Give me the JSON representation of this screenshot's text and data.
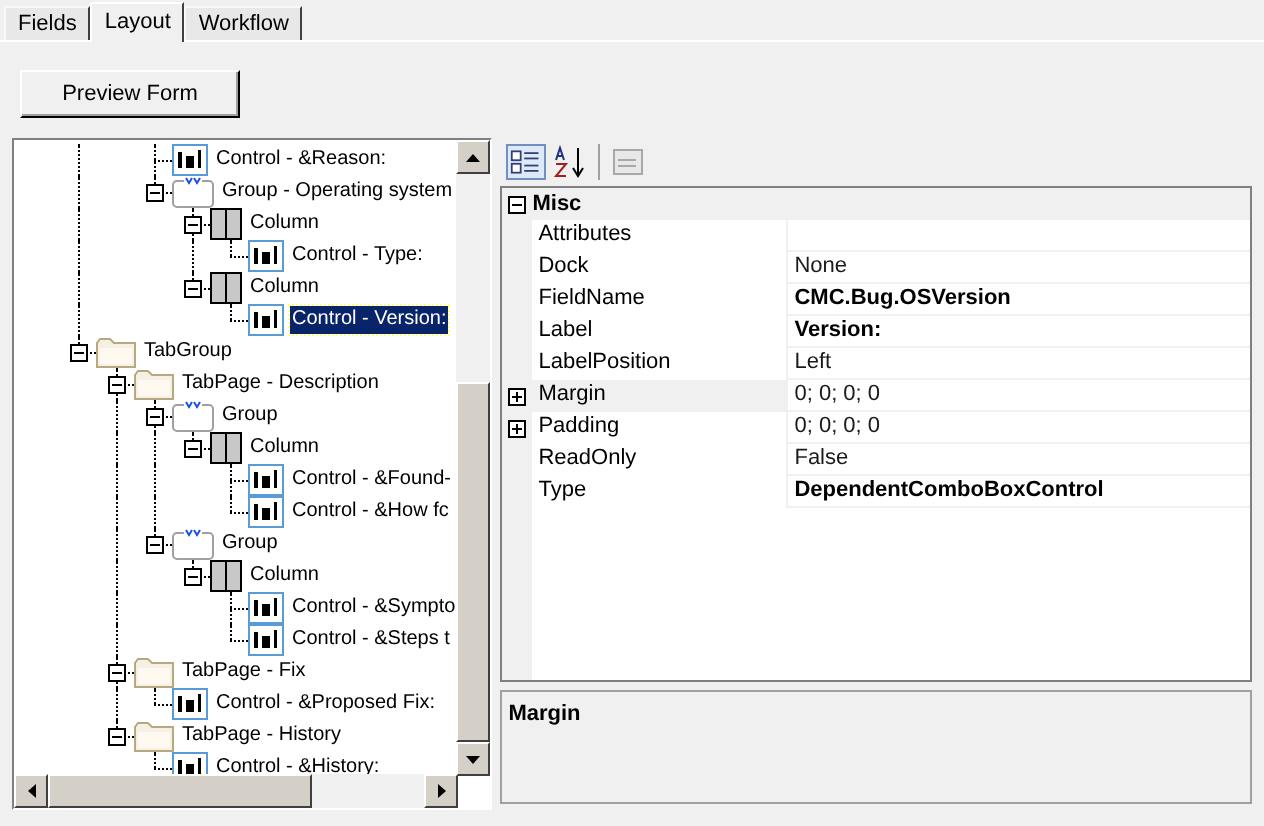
{
  "tabs": [
    {
      "label": "Fields",
      "selected": false
    },
    {
      "label": "Layout",
      "selected": true
    },
    {
      "label": "Workflow",
      "selected": false
    }
  ],
  "preview_button": "Preview Form",
  "tree": {
    "items": [
      {
        "children": [
          {
            "children": [
              {
                "children": [
                  {
                    "kind": "control",
                    "label": "Control - &Reason:",
                    "selected": false
                  },
                  {
                    "kind": "group",
                    "label": "Group - Operating system",
                    "expanded": true,
                    "selected": false,
                    "children": [
                      {
                        "kind": "column",
                        "label": "Column",
                        "expanded": true,
                        "selected": false,
                        "children": [
                          {
                            "kind": "control",
                            "label": "Control - Type:",
                            "selected": false
                          }
                        ]
                      },
                      {
                        "kind": "column",
                        "label": "Column",
                        "expanded": true,
                        "selected": false,
                        "children": [
                          {
                            "kind": "control",
                            "label": "Control - Version:",
                            "selected": true
                          }
                        ]
                      }
                    ]
                  }
                ]
              }
            ]
          },
          {
            "kind": "folder",
            "label": "TabGroup",
            "expanded": true,
            "selected": false,
            "children": [
              {
                "kind": "folder",
                "label": "TabPage - Description",
                "expanded": true,
                "selected": false,
                "children": [
                  {
                    "kind": "group",
                    "label": "Group",
                    "expanded": true,
                    "selected": false,
                    "children": [
                      {
                        "kind": "column",
                        "label": "Column",
                        "expanded": true,
                        "selected": false,
                        "children": [
                          {
                            "kind": "control",
                            "label": "Control - &Found-",
                            "selected": false
                          },
                          {
                            "kind": "control",
                            "label": "Control - &How fc",
                            "selected": false
                          }
                        ]
                      }
                    ]
                  },
                  {
                    "kind": "group",
                    "label": "Group",
                    "expanded": true,
                    "selected": false,
                    "children": [
                      {
                        "kind": "column",
                        "label": "Column",
                        "expanded": true,
                        "selected": false,
                        "children": [
                          {
                            "kind": "control",
                            "label": "Control - &Sympto",
                            "selected": false
                          },
                          {
                            "kind": "control",
                            "label": "Control - &Steps t",
                            "selected": false
                          }
                        ]
                      }
                    ]
                  }
                ]
              },
              {
                "kind": "folder",
                "label": "TabPage - Fix",
                "expanded": true,
                "selected": false,
                "children": [
                  {
                    "kind": "control",
                    "label": "Control - &Proposed Fix:",
                    "selected": false
                  }
                ]
              },
              {
                "kind": "folder",
                "label": "TabPage - History",
                "expanded": true,
                "selected": false,
                "children": [
                  {
                    "kind": "control",
                    "label": "Control - &History:",
                    "selected": false
                  }
                ]
              }
            ]
          }
        ]
      }
    ]
  },
  "properties": {
    "category": {
      "label": "Misc",
      "expanded": true
    },
    "rows": [
      {
        "name": "Attributes",
        "value": "",
        "selected": false
      },
      {
        "name": "Dock",
        "value": "None",
        "bold": false,
        "selected": false
      },
      {
        "name": "FieldName",
        "value": "CMC.Bug.OSVersion",
        "bold": true,
        "selected": false
      },
      {
        "name": "Label",
        "value": "Version:",
        "bold": true,
        "selected": false
      },
      {
        "name": "LabelPosition",
        "value": "Left",
        "bold": false,
        "selected": false
      },
      {
        "name": "Margin",
        "value": "0; 0; 0; 0",
        "bold": false,
        "selected": true,
        "expandable": true
      },
      {
        "name": "Padding",
        "value": "0; 0; 0; 0",
        "bold": false,
        "selected": false,
        "expandable": true
      },
      {
        "name": "ReadOnly",
        "value": "False",
        "bold": false,
        "selected": false
      },
      {
        "name": "Type",
        "value": "DependentComboBoxControl",
        "bold": true,
        "selected": false
      }
    ]
  },
  "description": {
    "title": "Margin"
  }
}
